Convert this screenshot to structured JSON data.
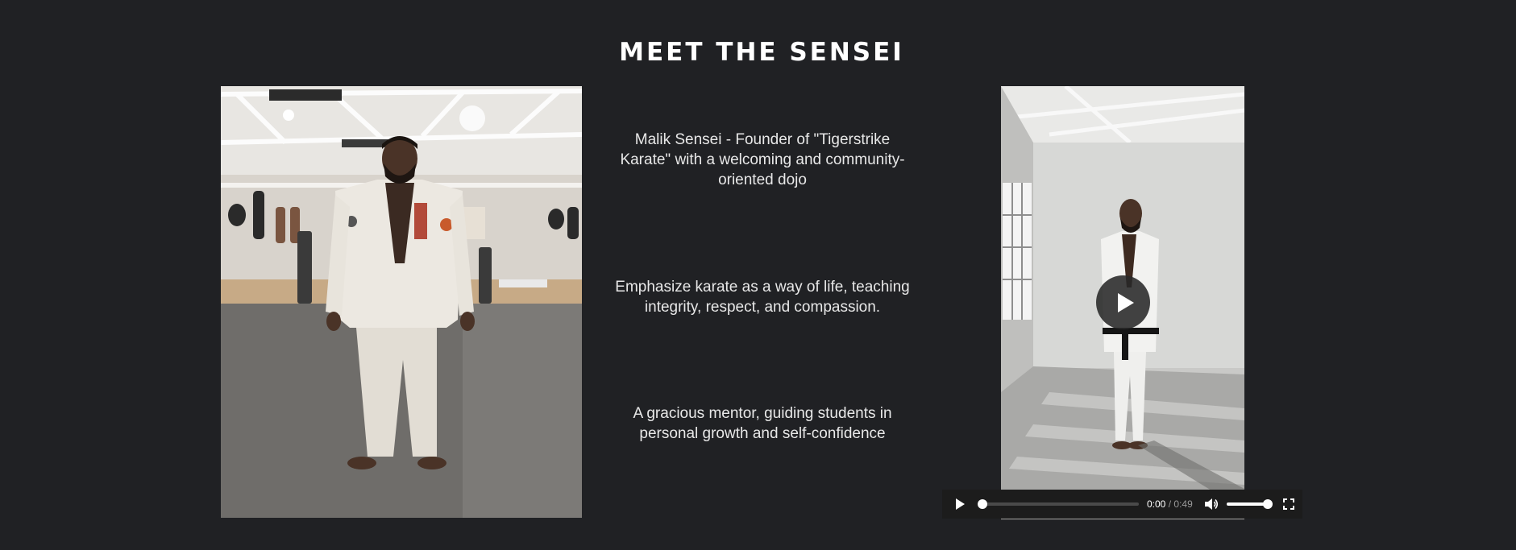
{
  "section": {
    "title": "MEET THE SENSEI"
  },
  "bio": {
    "line1": "Malik Sensei - Founder of \"Tigerstrike Karate\" with a welcoming and community-oriented dojo",
    "line2": "Emphasize karate as a way of life, teaching integrity, respect, and compassion.",
    "line3": "A gracious mentor, guiding students in personal growth and self-confidence"
  },
  "video": {
    "current_time": "0:00",
    "separator": "/",
    "duration": "0:49",
    "progress": 0,
    "volume": 1
  },
  "icons": {
    "play": "play-icon",
    "volume": "volume-icon",
    "fullscreen": "fullscreen-icon"
  },
  "colors": {
    "background": "#202124",
    "title": "#ffffff",
    "text": "#e8e8e8"
  }
}
